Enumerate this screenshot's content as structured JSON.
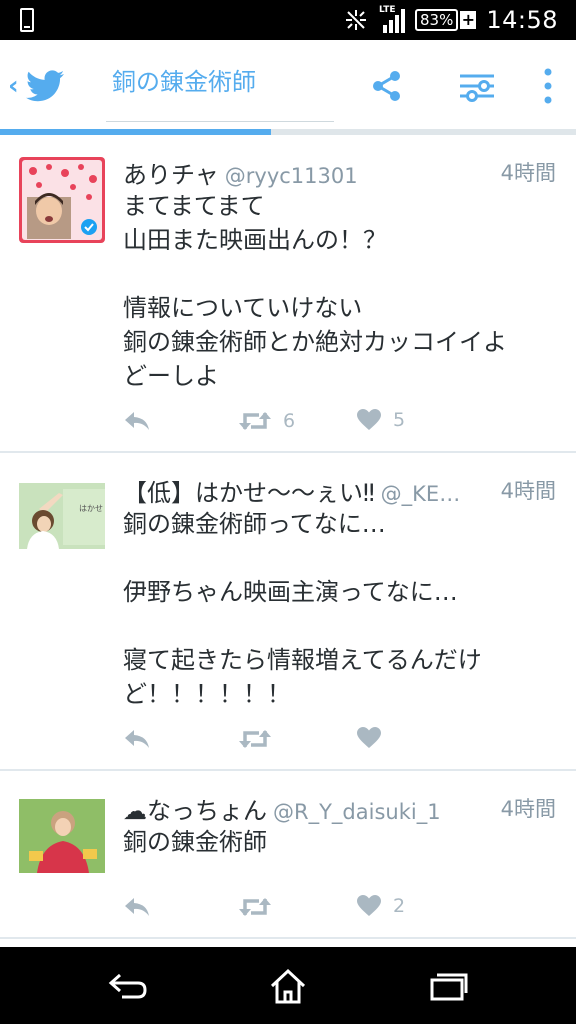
{
  "status_bar": {
    "time": "14:58",
    "battery": "83%",
    "network": "LTE",
    "icons": [
      "phone-icon",
      "mute-icon",
      "signal-icon",
      "battery-charging-icon"
    ]
  },
  "header": {
    "title": "銅の錬金術師",
    "icons": [
      "back-chevron-icon",
      "twitter-bird-icon",
      "share-icon",
      "filter-sliders-icon",
      "overflow-menu-icon"
    ],
    "load_progress": 0.47
  },
  "colors": {
    "accent": "#55acee",
    "text": "#292f33",
    "secondary": "#8899a6",
    "action_icon": "#aab8c2",
    "divider": "#e1e8ed",
    "system_bar": "#000000"
  },
  "tweets": [
    {
      "name": "ありチャ",
      "handle": "@ryyc11301",
      "time": "4時間",
      "text": "まてまてまて\n山田また映画出んの！？\n\n情報についていけない\n銅の錬金術師とか絶対カッコイイよ\nどーしよ",
      "retweets": "6",
      "likes": "5"
    },
    {
      "name": "【低】はかせ〜〜ぇい‼",
      "handle": "@_KE…",
      "time": "4時間",
      "text": "銅の錬金術師ってなに…\n\n伊野ちゃん映画主演ってなに…\n\n寝て起きたら情報増えてるんだけ\nど！！！！！！",
      "retweets": "",
      "likes": ""
    },
    {
      "name": "☁なっちょん",
      "handle": "@R_Y_daisuki_1",
      "time": "4時間",
      "text": "銅の錬金術師",
      "retweets": "",
      "likes": "2"
    }
  ],
  "nav_bar": {
    "icons": [
      "nav-back-icon",
      "nav-home-icon",
      "nav-recents-icon"
    ]
  }
}
